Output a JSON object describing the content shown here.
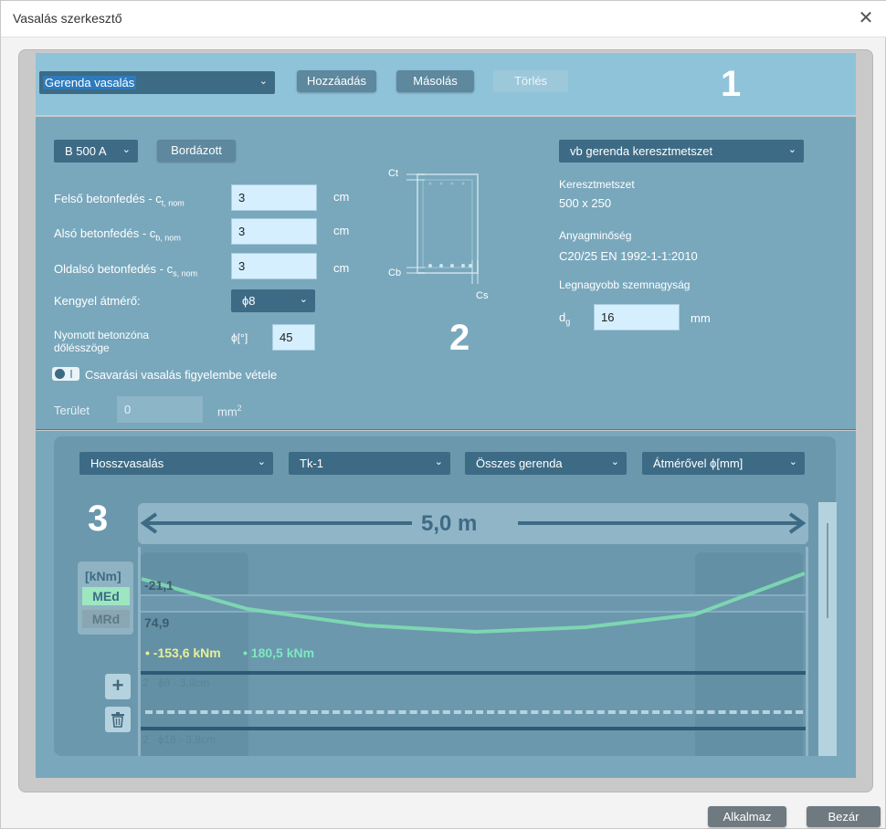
{
  "window": {
    "title": "Vasalás szerkesztő"
  },
  "panel1": {
    "type_select": "Gerenda vasalás",
    "add_label": "Hozzáadás",
    "copy_label": "Másolás",
    "delete_label": "Törlés",
    "marker": "1"
  },
  "panel2": {
    "steel_select": "B 500 A",
    "ribbed_label": "Bordázott",
    "top_cover_label": "Felső betonfedés - c",
    "top_cover_sub": "t, nom",
    "top_cover_value": "3",
    "bottom_cover_label": "Alsó betonfedés - c",
    "bottom_cover_sub": "b, nom",
    "bottom_cover_value": "3",
    "side_cover_label": "Oldalsó betonfedés - c",
    "side_cover_sub": "s, nom",
    "side_cover_value": "3",
    "unit_cm": "cm",
    "stirrup_label": "Kengyel átmérő:",
    "stirrup_value": "ϕ8",
    "strut_label_1": "Nyomott betonzóna",
    "strut_label_2": "dőlésszöge",
    "strut_unit": "ϕ[°]",
    "strut_value": "45",
    "torsion_label": "Csavarási vasalás figyelembe vétele",
    "area_label": "Terület",
    "area_value": "0",
    "area_unit": "mm",
    "area_unit_sup": "2",
    "section_select": "vb gerenda keresztmetszet",
    "section_heading": "Keresztmetszet",
    "section_value": "500 x 250",
    "material_heading": "Anyagminőség",
    "material_value": "C20/25 EN 1992-1-1:2010",
    "aggregate_heading": "Legnagyobb szemnagyság",
    "dg_label": "d",
    "dg_sub": "g",
    "dg_value": "16",
    "dg_unit": "mm",
    "ct_label": "Ct",
    "cb_label": "Cb",
    "cs_label": "Cs",
    "marker": "2"
  },
  "panel3": {
    "rebar_select": "Hosszvasalás",
    "loadcase_select": "Tk-1",
    "beam_select": "Összes gerenda",
    "display_select": "Átmérővel ϕ[mm]",
    "marker": "3",
    "span_label": "5,0 m",
    "legend_unit": "[kNm]",
    "legend_med": "MEd",
    "legend_mrd": "MRd",
    "moment_top": "-21,1",
    "moment_bottom": "74,9",
    "med_min": "-153,6 kNm",
    "med_max": "180,5 kNm",
    "top_bar": "2   ϕ8 - 3,8cm",
    "bottom_bar": "2   ϕ16 - 3,8cm",
    "add_icon": "+",
    "colors": {
      "med_curve": "#7fe0b3",
      "med_min_text": "#e8ef9a",
      "med_max_text": "#7fe8c0"
    }
  },
  "footer": {
    "apply_label": "Alkalmaz",
    "close_label": "Bezár"
  }
}
